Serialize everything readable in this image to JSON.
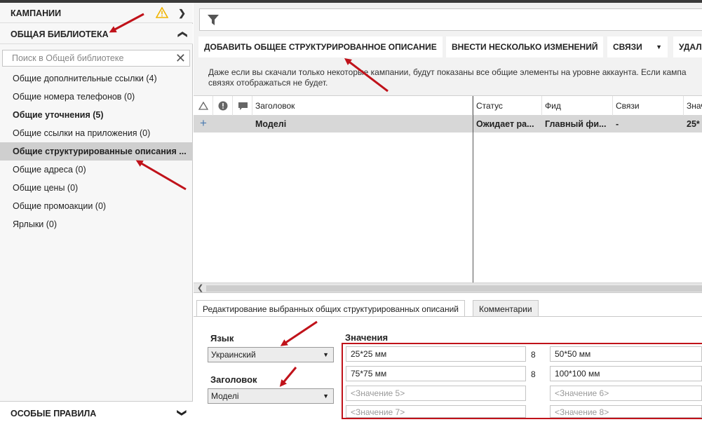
{
  "sidebar": {
    "campaigns_label": "КАМПАНИИ",
    "library_label": "ОБЩАЯ БИБЛИОТЕКА",
    "search_placeholder": "Поиск в Общей библиотеке",
    "items": [
      {
        "label": "Общие дополнительные ссылки (4)"
      },
      {
        "label": "Общие номера телефонов (0)"
      },
      {
        "label": "Общие уточнения (5)"
      },
      {
        "label": "Общие ссылки на приложения (0)"
      },
      {
        "label": "Общие структурированные описания ..."
      },
      {
        "label": "Общие адреса (0)"
      },
      {
        "label": "Общие цены (0)"
      },
      {
        "label": "Общие промоакции (0)"
      },
      {
        "label": "Ярлыки (0)"
      }
    ],
    "rules_label": "ОСОБЫЕ ПРАВИЛА"
  },
  "toolbar": {
    "add_label": "ДОБАВИТЬ ОБЩЕЕ СТРУКТУРИРОВАННОЕ ОПИСАНИЕ",
    "multi_label": "ВНЕСТИ НЕСКОЛЬКО ИЗМЕНЕНИЙ",
    "links_label": "СВЯЗИ",
    "delete_label": "УДАЛ"
  },
  "note": {
    "line1": "Даже если вы скачали только некоторые кампании, будут показаны все общие элементы на уровне аккаунта. Если кампа",
    "line2": "связях отображаться не будет."
  },
  "grid": {
    "headers": {
      "title": "Заголовок",
      "status": "Статус",
      "feed": "Фид",
      "links": "Связи",
      "value": "Знач"
    },
    "row": {
      "title": "Моделі",
      "status": "Ожидает ра...",
      "feed": "Главный фи...",
      "links": "-",
      "value": "25*"
    }
  },
  "editor": {
    "tab_edit": "Редактирование выбранных общих структурированных описаний",
    "tab_comments": "Комментарии",
    "language_label": "Язык",
    "language_value": "Украинский",
    "header_label": "Заголовок",
    "header_value": "Моделі",
    "values_label": "Значения",
    "values": {
      "v1": "25*25 мм",
      "v2": "50*50 мм",
      "v3": "75*75 мм",
      "v4": "100*100 мм",
      "v5": "<Значение 5>",
      "v6": "<Значение 6>",
      "v7": "<Значение 7>",
      "v8": "<Значение 8>"
    },
    "separator": "8"
  },
  "colors": {
    "annotation_arrow": "#c0121a",
    "warning": "#f0b400",
    "selected_row": "#d7d7d7"
  }
}
